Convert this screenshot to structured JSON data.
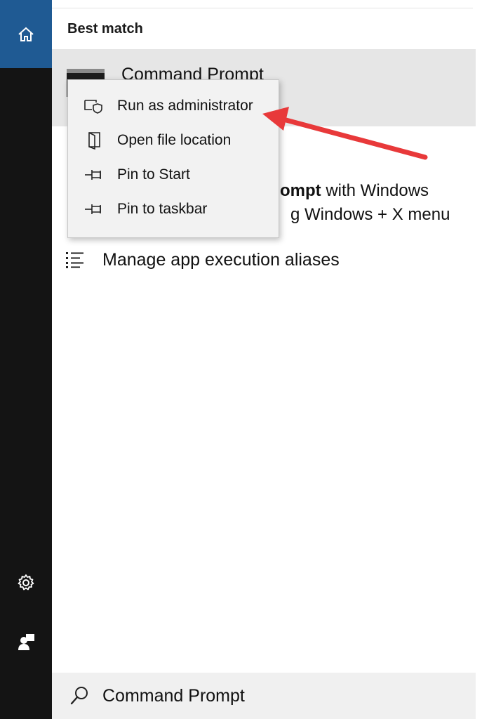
{
  "rail": {
    "home_icon": "home-icon",
    "settings_icon": "gear-icon",
    "user_icon": "user-icon",
    "accent_color": "#1f5a93",
    "background_color": "#141414"
  },
  "results": {
    "section_header": "Best match",
    "best_match": {
      "title": "Command Prompt"
    },
    "tip": {
      "line1_bold": "ompt",
      "line1_rest": " with Windows",
      "line2": "g Windows + X menu"
    },
    "manage": {
      "label": "Manage app execution aliases"
    }
  },
  "context_menu": {
    "items": [
      {
        "label": "Run as administrator",
        "icon": "shield-icon"
      },
      {
        "label": "Open file location",
        "icon": "folder-open-icon"
      },
      {
        "label": "Pin to Start",
        "icon": "pin-icon"
      },
      {
        "label": "Pin to taskbar",
        "icon": "pin-icon"
      }
    ]
  },
  "annotation": {
    "arrow_color": "#e8393a"
  },
  "search": {
    "value": "Command Prompt",
    "icon": "search-icon"
  }
}
